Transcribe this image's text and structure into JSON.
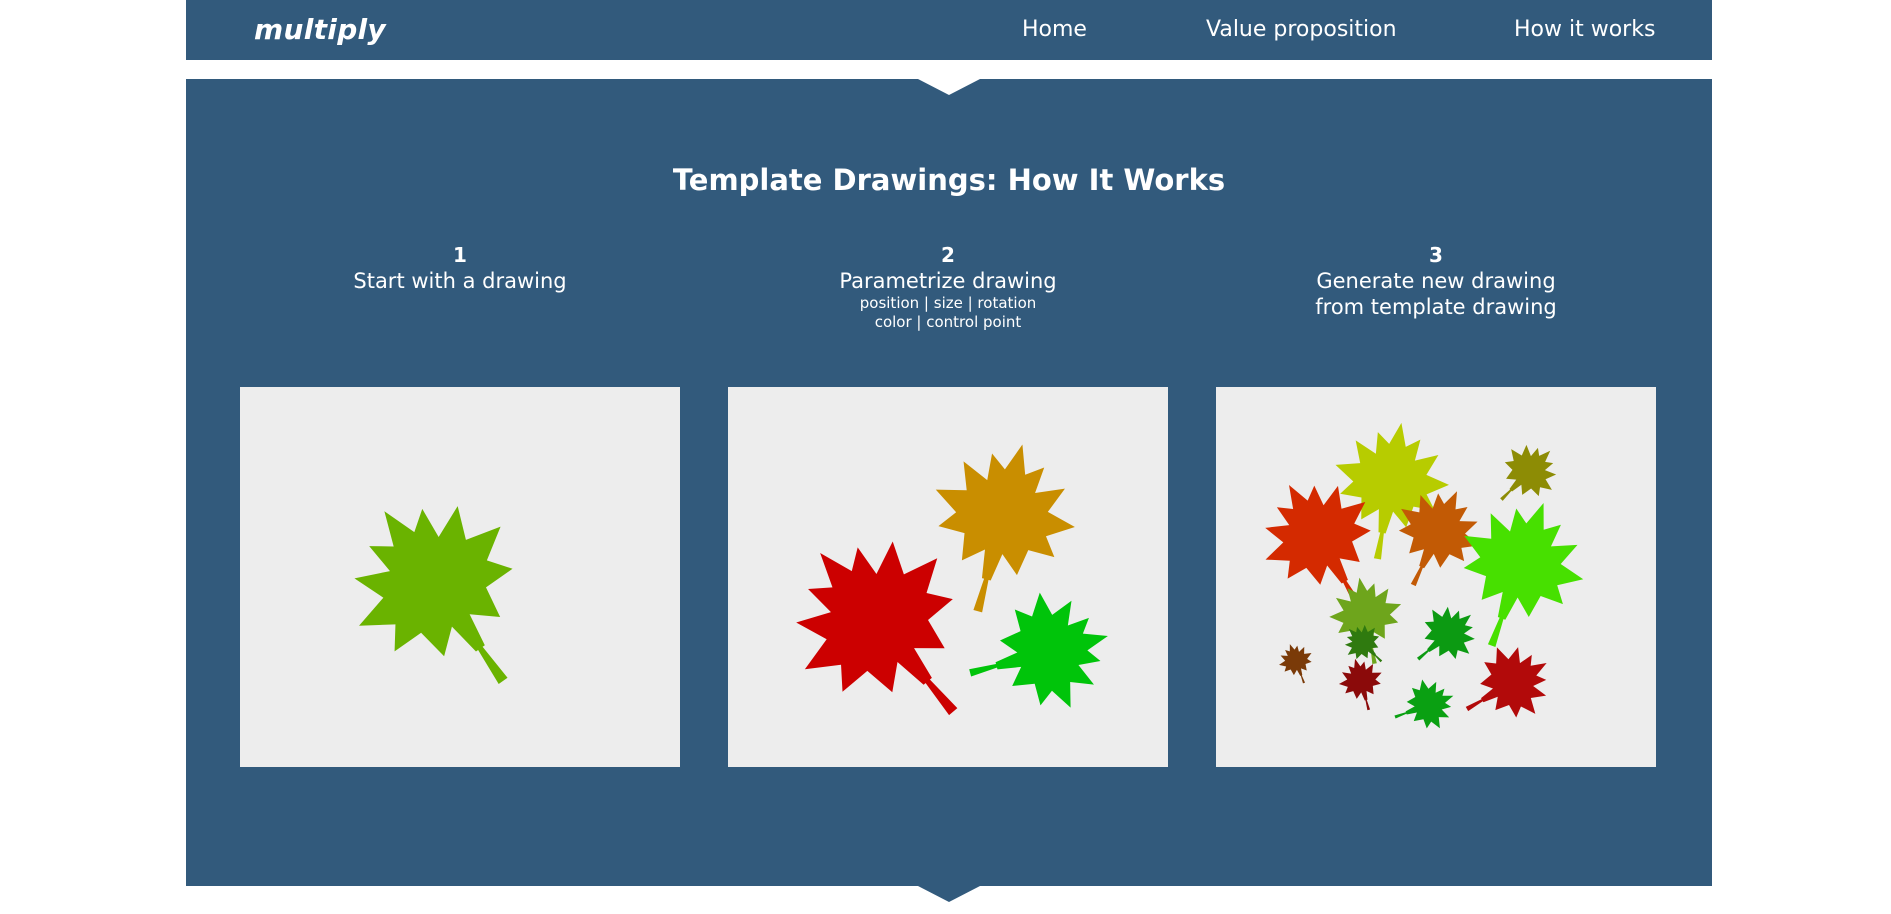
{
  "nav": {
    "brand": "multiply",
    "links": [
      "Home",
      "Value proposition",
      "How it works"
    ]
  },
  "section": {
    "title": "Template Drawings: How It Works",
    "steps": [
      {
        "num": "1",
        "title": "Start with a drawing",
        "sub": ""
      },
      {
        "num": "2",
        "title": "Parametrize drawing",
        "sub": "position | size | rotation\ncolor | control point"
      },
      {
        "num": "3",
        "title": "Generate new drawing\nfrom template drawing",
        "sub": ""
      }
    ]
  },
  "colors": {
    "nav_bg": "#325a7c",
    "section_bg": "#325a7c",
    "panel_bg": "#ededed",
    "text": "#ffffff"
  },
  "panels": {
    "panel1": {
      "icon": "maple-leaf-icon",
      "leaf_colors": [
        "#6ab300"
      ]
    },
    "panel2": {
      "icon": "maple-leaf-icon",
      "leaf_colors": [
        "#cc0000",
        "#c98e00",
        "#00c40a"
      ]
    },
    "panel3": {
      "icon": "maple-leaf-icon",
      "leaf_colors": [
        "#b7cc00",
        "#d42a00",
        "#c25a05",
        "#8d8c05",
        "#47e000",
        "#6ea51c",
        "#0c9a12",
        "#7a3a08",
        "#8b0a0a",
        "#b20a0a",
        "#0aa012",
        "#2f7a0f"
      ]
    }
  }
}
